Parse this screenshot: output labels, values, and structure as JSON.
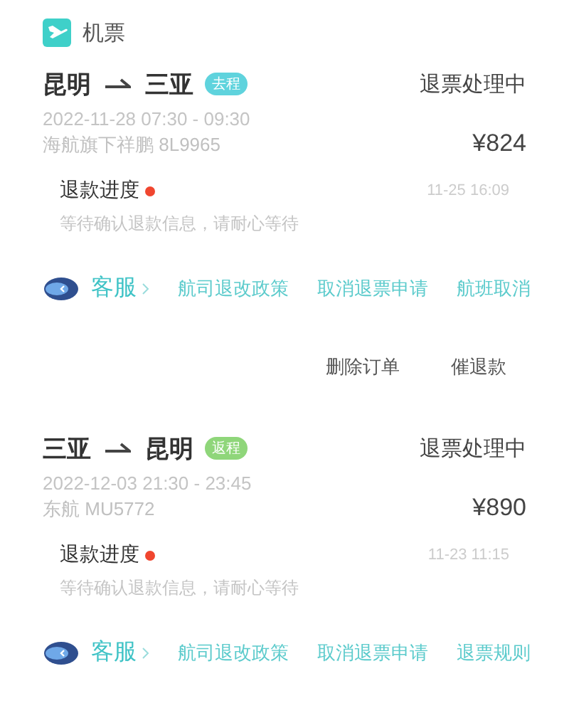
{
  "header": {
    "title": "机票"
  },
  "orders": [
    {
      "from": "昆明",
      "to": "三亚",
      "tag": {
        "label": "去程",
        "color": "#5fd3dd"
      },
      "status": "退票处理中",
      "time": "2022-11-28 07:30 - 09:30",
      "flight": "海航旗下祥鹏 8L9965",
      "price": "¥824",
      "progress": {
        "title": "退款进度",
        "time": "11-25 16:09",
        "note": "等待确认退款信息，请耐心等待"
      },
      "service": "客服",
      "links": [
        "航司退改政策",
        "取消退票申请",
        "航班取消"
      ],
      "actions": [
        "删除订单",
        "催退款"
      ]
    },
    {
      "from": "三亚",
      "to": "昆明",
      "tag": {
        "label": "返程",
        "color": "#8fd67a"
      },
      "status": "退票处理中",
      "time": "2022-12-03 21:30 - 23:45",
      "flight": "东航 MU5772",
      "price": "¥890",
      "progress": {
        "title": "退款进度",
        "time": "11-23 11:15",
        "note": "等待确认退款信息，请耐心等待"
      },
      "service": "客服",
      "links": [
        "航司退改政策",
        "取消退票申请",
        "退票规则"
      ]
    }
  ]
}
